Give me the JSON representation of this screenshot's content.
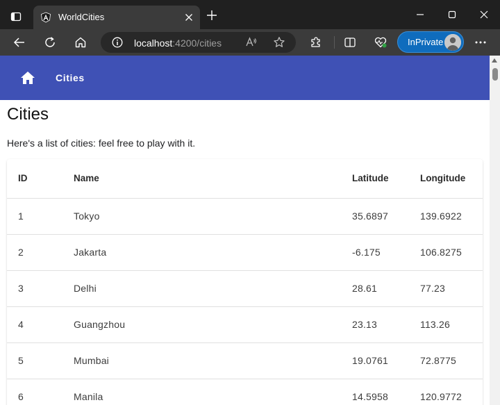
{
  "browser": {
    "tab_title": "WorldCities",
    "url_host": "localhost",
    "url_rest": ":4200/cities",
    "inprivate_label": "InPrivate"
  },
  "app": {
    "nav_label": "Cities"
  },
  "page": {
    "title": "Cities",
    "intro": "Here's a list of cities: feel free to play with it."
  },
  "table": {
    "headers": {
      "id": "ID",
      "name": "Name",
      "latitude": "Latitude",
      "longitude": "Longitude"
    },
    "rows": [
      {
        "id": "1",
        "name": "Tokyo",
        "latitude": "35.6897",
        "longitude": "139.6922"
      },
      {
        "id": "2",
        "name": "Jakarta",
        "latitude": "-6.175",
        "longitude": "106.8275"
      },
      {
        "id": "3",
        "name": "Delhi",
        "latitude": "28.61",
        "longitude": "77.23"
      },
      {
        "id": "4",
        "name": "Guangzhou",
        "latitude": "23.13",
        "longitude": "113.26"
      },
      {
        "id": "5",
        "name": "Mumbai",
        "latitude": "19.0761",
        "longitude": "72.8775"
      },
      {
        "id": "6",
        "name": "Manila",
        "latitude": "14.5958",
        "longitude": "120.9772"
      }
    ]
  },
  "colors": {
    "app_bar": "#3f51b5",
    "browser_frame": "#202020",
    "browser_toolbar": "#3b3b3b",
    "inprivate_badge": "#0f6cbd"
  },
  "icons": {
    "tab_actions": "tab-actions-icon",
    "favicon": "angular-logo-icon",
    "close_tab": "close-icon",
    "new_tab": "plus-icon",
    "back": "back-arrow-icon",
    "refresh": "refresh-icon",
    "home": "home-icon",
    "site_info": "info-icon",
    "read_aloud": "read-aloud-icon",
    "favorite": "star-icon",
    "extensions": "puzzle-icon",
    "split_screen": "split-screen-icon",
    "browser_essentials": "heart-pulse-icon",
    "more": "more-dots-icon",
    "app_home": "home-icon"
  }
}
